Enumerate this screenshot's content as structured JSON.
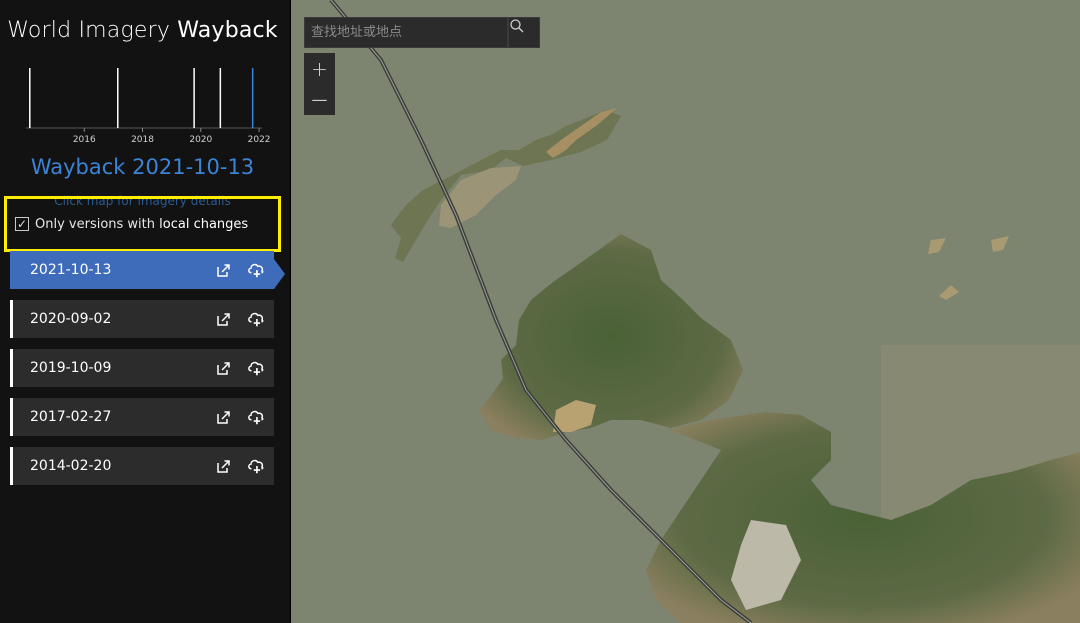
{
  "app": {
    "title_light": "World Imagery",
    "title_bold": "Wayback"
  },
  "timeline": {
    "ticks": [
      "2016",
      "2018",
      "2020",
      "2022"
    ],
    "release_years": [
      2014.13,
      2017.15,
      2019.77,
      2020.67,
      2021.78
    ],
    "selected_year": 2021.78,
    "year_range": [
      2014.0,
      2022.1
    ],
    "colors": {
      "release": "#ffffff",
      "selected": "#3c84d6"
    }
  },
  "wayback": {
    "title": "Wayback 2021-10-13",
    "hint": "Click map for imagery details"
  },
  "filter": {
    "checked": true,
    "label_a": "Only versions with ",
    "label_b": "local changes",
    "checkmark": "✓"
  },
  "versions": [
    {
      "date": "2021-10-13",
      "active": true
    },
    {
      "date": "2020-09-02",
      "active": false
    },
    {
      "date": "2019-10-09",
      "active": false
    },
    {
      "date": "2017-02-27",
      "active": false
    },
    {
      "date": "2014-02-20",
      "active": false
    }
  ],
  "search": {
    "placeholder": "查找地址或地点",
    "icon": "search-icon"
  },
  "zoom": {
    "in_label": "+",
    "out_label": "—"
  },
  "colors": {
    "accent": "#3c84d6",
    "active_row": "#3e6cba",
    "highlight": "#ffee00",
    "water": "#7d8470"
  }
}
